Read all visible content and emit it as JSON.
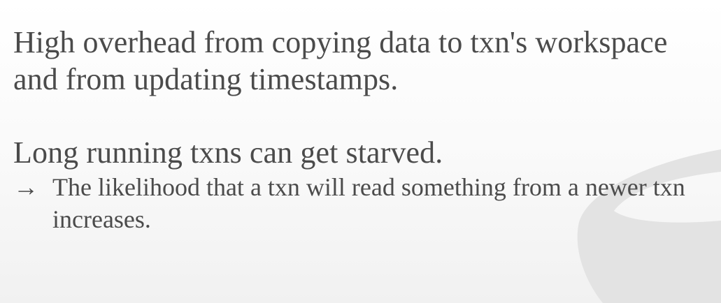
{
  "slide": {
    "bullets": [
      "High overhead from copying data to txn's workspace and from updating timestamps.",
      "Long running txns can get starved."
    ],
    "sub_bullet": {
      "marker": "→",
      "text": "The likelihood that a txn will read something from a newer txn increases."
    }
  },
  "colors": {
    "text": "#4b4b4b",
    "watermark": "#e3e3e3"
  }
}
